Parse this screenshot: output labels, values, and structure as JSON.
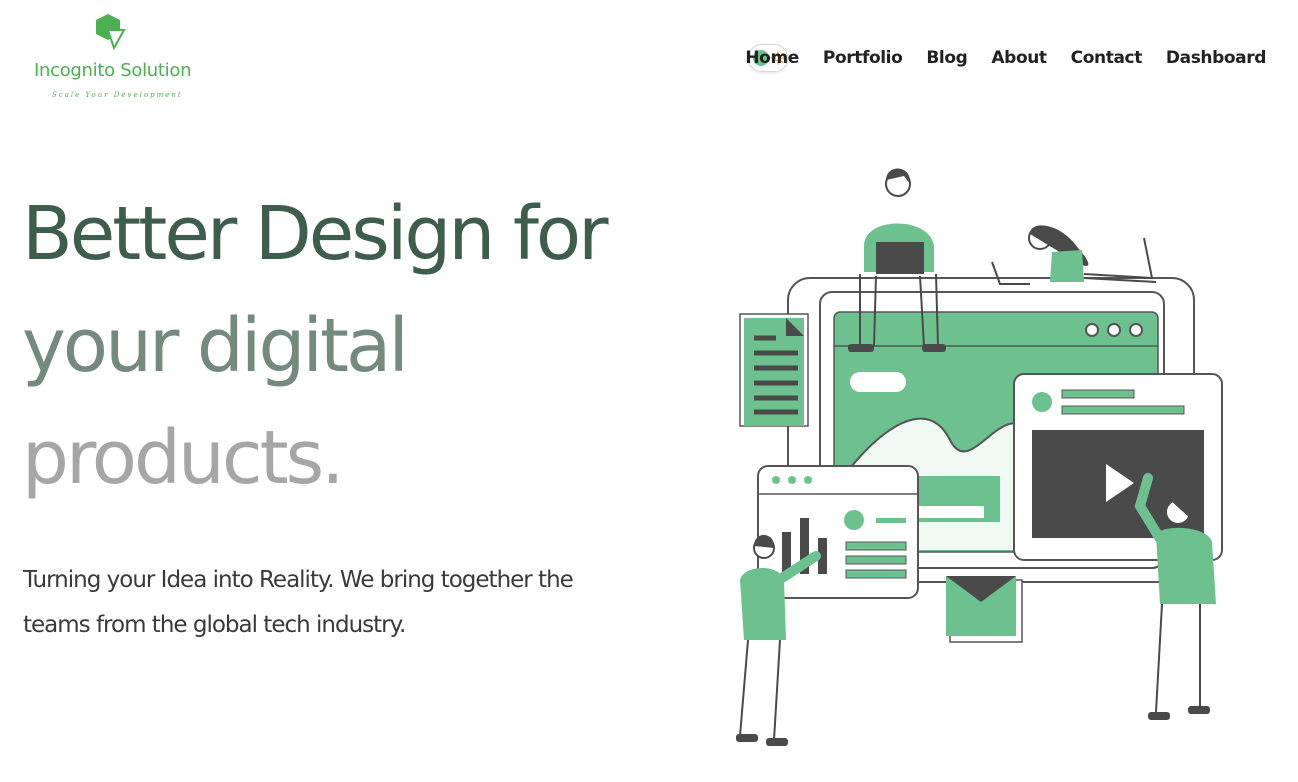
{
  "brand": {
    "name": "Incognito Solution",
    "tagline": "Scale Your Development",
    "color": "#4caf50"
  },
  "theme_toggle": {
    "state": "light",
    "icon": "sun-icon",
    "knob_color": "#6cc18e"
  },
  "nav": {
    "items": [
      {
        "label": "Home"
      },
      {
        "label": "Portfolio"
      },
      {
        "label": "Blog"
      },
      {
        "label": "About"
      },
      {
        "label": "Contact"
      },
      {
        "label": "Dashboard"
      }
    ]
  },
  "hero": {
    "title_lines": [
      "Better Design for",
      "your digital",
      "products."
    ],
    "title_colors": [
      "#3d5e4c",
      "#738a7e",
      "#a6a6a6"
    ],
    "subtitle": "Turning your Idea into Reality. We bring together the teams from the global tech industry."
  },
  "illustration": {
    "accent_color": "#6cc18e",
    "dark_color": "#4a4a4a"
  }
}
